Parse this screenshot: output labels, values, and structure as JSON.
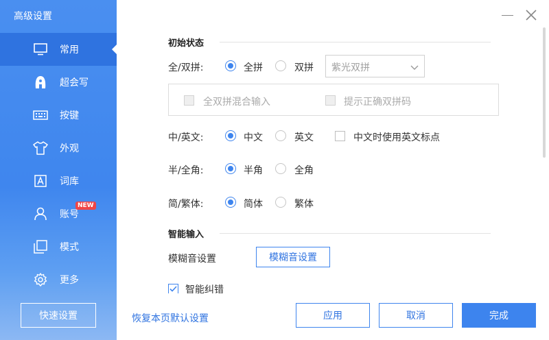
{
  "window": {
    "title": "高级设置"
  },
  "sidebar": {
    "items": [
      {
        "label": "常用",
        "icon": "monitor-icon"
      },
      {
        "label": "超会写",
        "icon": "pen-nib-icon"
      },
      {
        "label": "按键",
        "icon": "keyboard-icon"
      },
      {
        "label": "外观",
        "icon": "tshirt-icon"
      },
      {
        "label": "词库",
        "icon": "text-box-icon"
      },
      {
        "label": "账号",
        "icon": "user-icon",
        "badge": "NEW"
      },
      {
        "label": "模式",
        "icon": "window-layers-icon"
      },
      {
        "label": "更多",
        "icon": "gear-icon"
      }
    ],
    "active_index": 0,
    "quick_button": "快速设置"
  },
  "sections": {
    "initial_state": {
      "title": "初始状态",
      "full_double": {
        "label": "全/双拼:",
        "options": [
          "全拼",
          "双拼"
        ],
        "selected": "全拼",
        "scheme_select": "紫光双拼",
        "mixed_input": "全双拼混合输入",
        "show_correct": "提示正确双拼码"
      },
      "cn_en": {
        "label": "中/英文:",
        "options": [
          "中文",
          "英文"
        ],
        "selected": "中文",
        "checkbox": "中文时使用英文标点"
      },
      "half_full": {
        "label": "半/全角:",
        "options": [
          "半角",
          "全角"
        ],
        "selected": "半角"
      },
      "simp_trad": {
        "label": "简/繁体:",
        "options": [
          "简体",
          "繁体"
        ],
        "selected": "简体"
      }
    },
    "smart_input": {
      "title": "智能输入",
      "fuzzy_label": "模糊音设置",
      "fuzzy_button": "模糊音设置",
      "partial_item": "智能纠错"
    }
  },
  "footer": {
    "restore_link": "恢复本页默认设置",
    "apply": "应用",
    "cancel": "取消",
    "done": "完成"
  },
  "colors": {
    "accent": "#3d84ee",
    "sidebar": "#4a8ff0",
    "active": "#2f73e0",
    "badge": "#f04646"
  }
}
